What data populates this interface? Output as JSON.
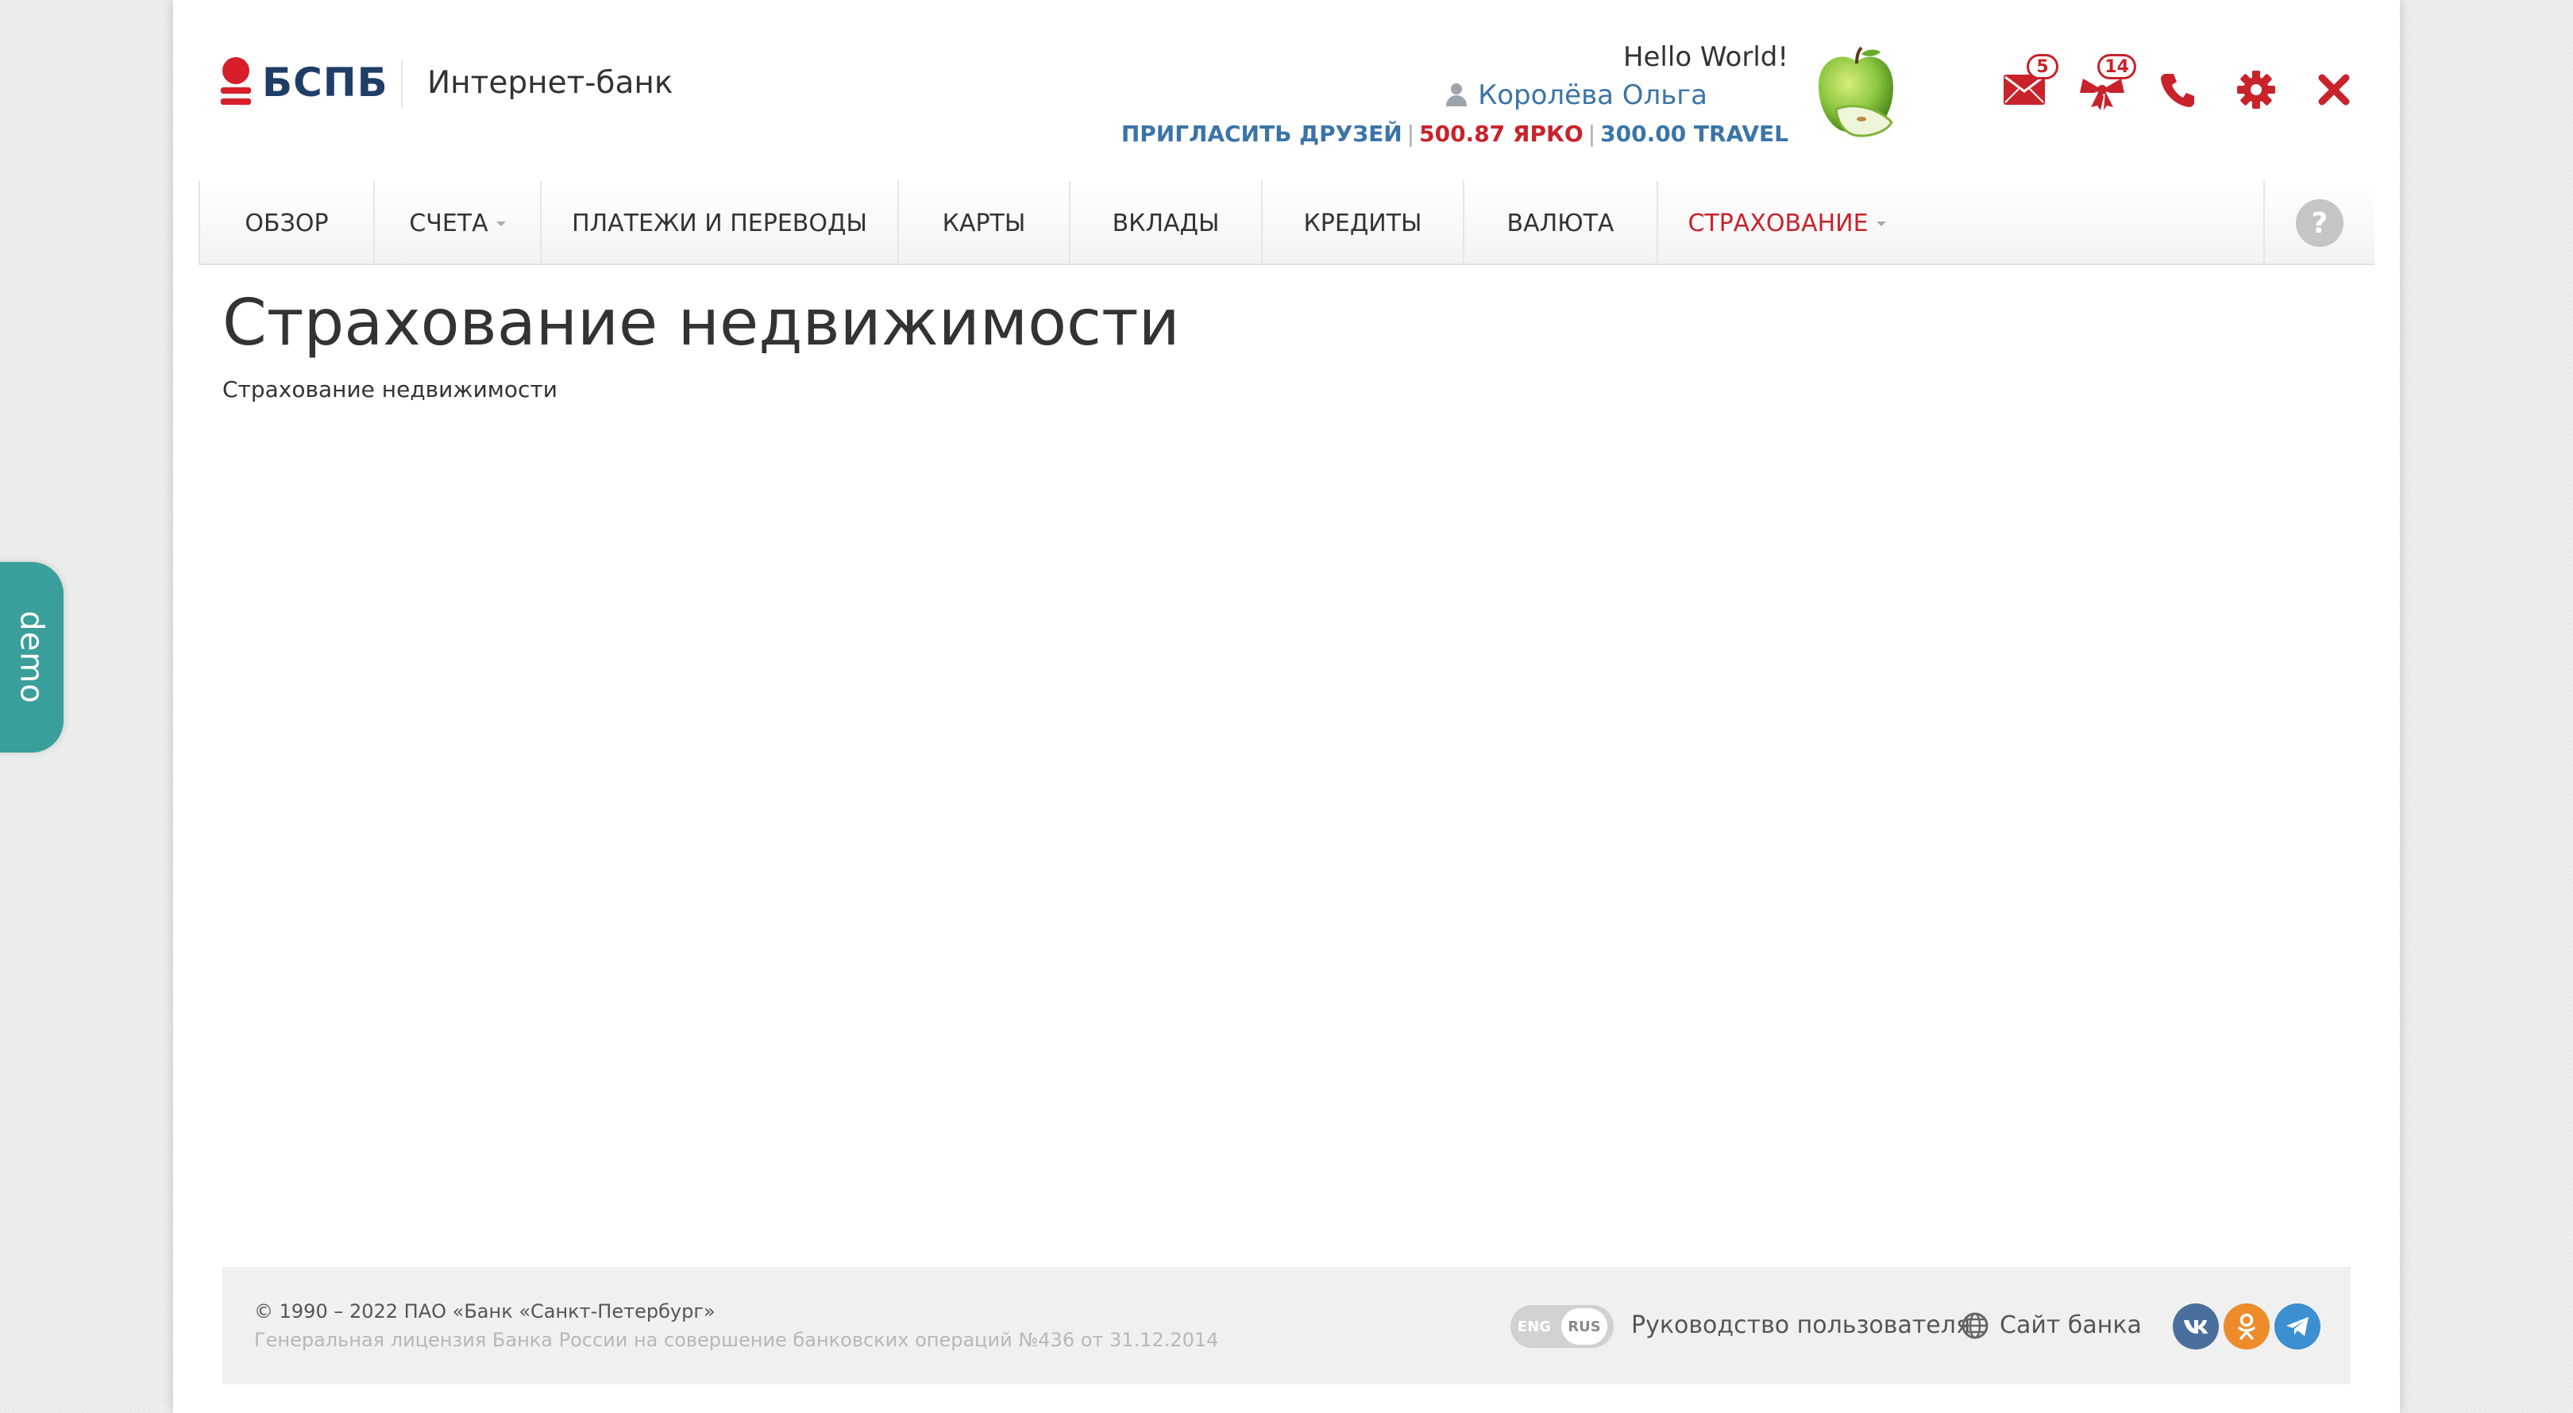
{
  "header": {
    "logo_text": "БСПБ",
    "brand_subtitle": "Интернет-банк",
    "greeting": "Hello World!",
    "user_name": "Королёва Ольга",
    "invite_link": "ПРИГЛАСИТЬ ДРУЗЕЙ",
    "bonus_yarko": "500.87 ЯРКО",
    "bonus_travel": "300.00 TRAVEL",
    "messages_count": "5",
    "offers_count": "14",
    "icons": [
      "mail-icon",
      "gift-icon",
      "phone-icon",
      "gear-icon",
      "close-icon"
    ]
  },
  "nav": {
    "items": [
      {
        "label": "ОБЗОР",
        "dropdown": false,
        "active": false
      },
      {
        "label": "СЧЕТА",
        "dropdown": true,
        "active": false
      },
      {
        "label": "ПЛАТЕЖИ И ПЕРЕВОДЫ",
        "dropdown": false,
        "active": false
      },
      {
        "label": "КАРТЫ",
        "dropdown": false,
        "active": false
      },
      {
        "label": "ВКЛАДЫ",
        "dropdown": false,
        "active": false
      },
      {
        "label": "КРЕДИТЫ",
        "dropdown": false,
        "active": false
      },
      {
        "label": "ВАЛЮТА",
        "dropdown": false,
        "active": false
      },
      {
        "label": "СТРАХОВАНИЕ",
        "dropdown": true,
        "active": true
      }
    ],
    "help_label": "?"
  },
  "main": {
    "title": "Страхование недвижимости",
    "subtitle": "Страхование недвижимости"
  },
  "footer": {
    "copyright": "© 1990 – 2022 ПАО «Банк «Санкт-Петербург»",
    "license": "Генеральная лицензия Банка России на совершение банковских операций №436 от 31.12.2014",
    "lang_eng": "ENG",
    "lang_rus": "RUS",
    "guide_link": "Руководство пользователя",
    "site_link": "Сайт банка",
    "social": [
      "vk-icon",
      "odnoklassniki-icon",
      "telegram-icon"
    ]
  },
  "demo_tab": "demo",
  "colors": {
    "brand_red": "#c8222b",
    "brand_blue": "#1f3e67",
    "link_blue": "#3b74a8",
    "demo_teal": "#3a9e9a"
  }
}
